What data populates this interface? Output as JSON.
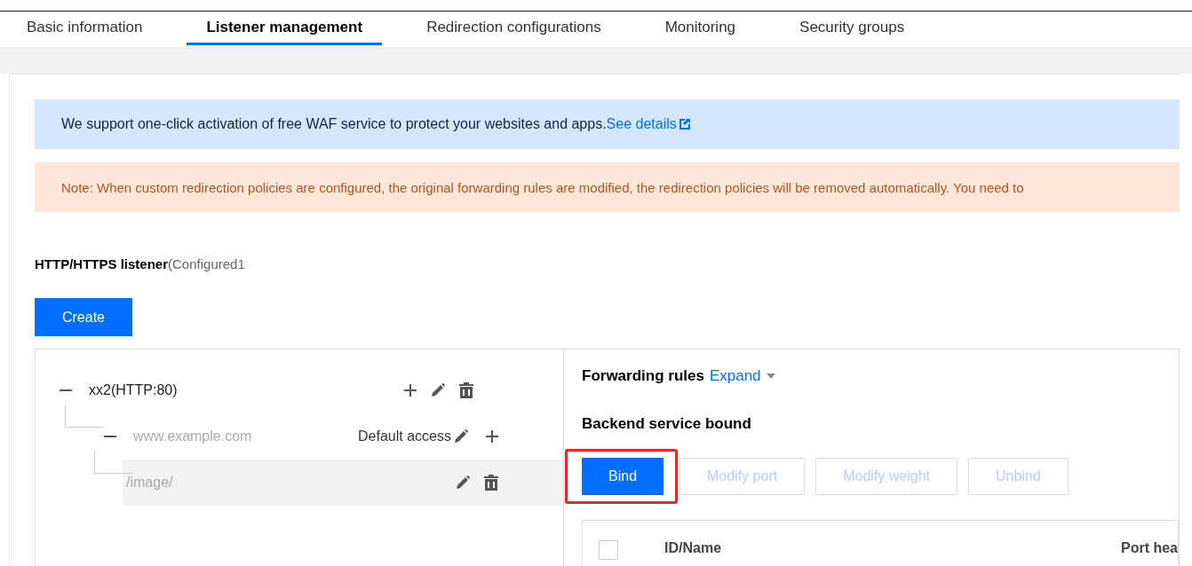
{
  "tabs": [
    {
      "label": "Basic information",
      "selected": false
    },
    {
      "label": "Listener management",
      "selected": true
    },
    {
      "label": "Redirection configurations",
      "selected": false
    },
    {
      "label": "Monitoring",
      "selected": false
    },
    {
      "label": "Security groups",
      "selected": false
    }
  ],
  "info_banner": {
    "text": "We support one-click activation of free WAF service to protect your websites and apps.",
    "link": "See details"
  },
  "note_banner": {
    "text": "Note: When custom redirection policies are configured, the original forwarding rules are modified, the redirection policies will be removed automatically. You need to"
  },
  "listener_section": {
    "title": "HTTP/HTTPS listener",
    "count": "(Configured1",
    "create_button": "Create"
  },
  "tree": [
    {
      "label": "xx2(HTTP:80)",
      "expanded": true,
      "selected": false,
      "muted": false,
      "actions": [
        {
          "kind": "add"
        },
        {
          "kind": "edit"
        },
        {
          "kind": "delete"
        }
      ],
      "children": [
        {
          "label": "www.example.com",
          "expanded": true,
          "selected": false,
          "muted": true,
          "tag": "Default access",
          "actions": [
            {
              "kind": "edit"
            },
            {
              "kind": "add"
            }
          ],
          "children": [
            {
              "label": "/image/",
              "selected": true,
              "muted": true,
              "actions": [
                {
                  "kind": "edit"
                },
                {
                  "kind": "delete"
                }
              ]
            }
          ]
        }
      ]
    }
  ],
  "forwarding": {
    "title": "Forwarding rules",
    "toggle": "Expand"
  },
  "backend": {
    "title": "Backend service bound",
    "buttons": [
      {
        "label": "Bind",
        "disabled": false,
        "highlighted": true
      },
      {
        "label": "Modify port",
        "disabled": true,
        "highlighted": false
      },
      {
        "label": "Modify weight",
        "disabled": true,
        "highlighted": false
      },
      {
        "label": "Unbind",
        "disabled": true,
        "highlighted": false
      }
    ],
    "table": {
      "select_all": {
        "checked": false
      },
      "columns": [
        "ID/Name",
        "Port hea"
      ]
    }
  }
}
